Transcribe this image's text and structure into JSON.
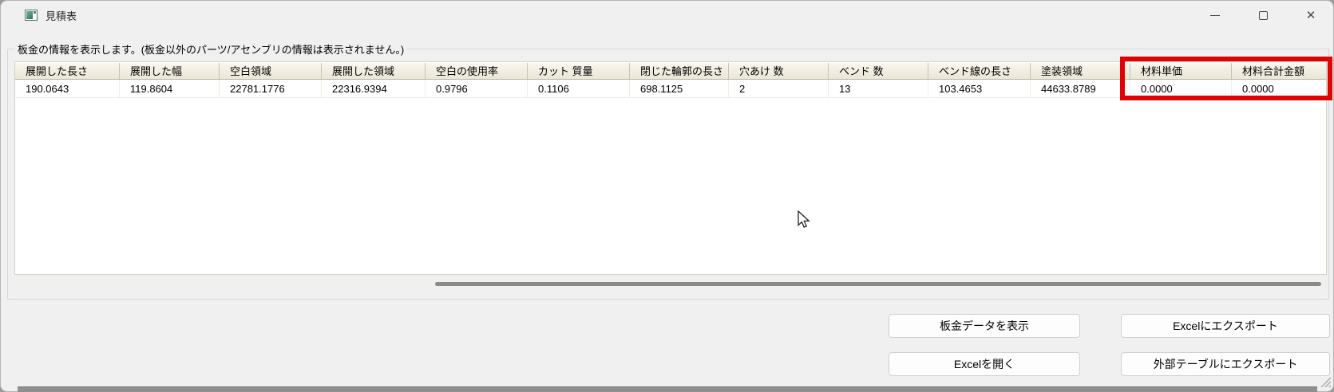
{
  "window": {
    "title": "見積表",
    "close_glyph": "✕"
  },
  "groupbox": {
    "label": "板金の情報を表示します。(板金以外のパーツ/アセンブリの情報は表示されません。)"
  },
  "table": {
    "columns": [
      {
        "header": "展開した長さ",
        "value": "190.0643"
      },
      {
        "header": "展開した幅",
        "value": "119.8604"
      },
      {
        "header": "空白領域",
        "value": "22781.1776"
      },
      {
        "header": "展開した領域",
        "value": "22316.9394"
      },
      {
        "header": "空白の使用率",
        "value": "0.9796"
      },
      {
        "header": "カット 質量",
        "value": "0.1106"
      },
      {
        "header": "閉じた輪郭の長さ",
        "value": "698.1125"
      },
      {
        "header": "穴あけ 数",
        "value": "2"
      },
      {
        "header": "ベンド 数",
        "value": "13"
      },
      {
        "header": "ベンド線の長さ",
        "value": "103.4653"
      },
      {
        "header": "塗装領域",
        "value": "44633.8789"
      },
      {
        "header": "材料単価",
        "value": "0.0000"
      },
      {
        "header": "材料合計金額",
        "value": "0.0000"
      }
    ]
  },
  "buttons": {
    "show_sheet_metal_data": "板金データを表示",
    "open_excel": "Excelを開く",
    "export_to_excel": "Excelにエクスポート",
    "export_to_external_table": "外部テーブルにエクスポート"
  },
  "annotation": {
    "highlight_color": "#e10000"
  }
}
